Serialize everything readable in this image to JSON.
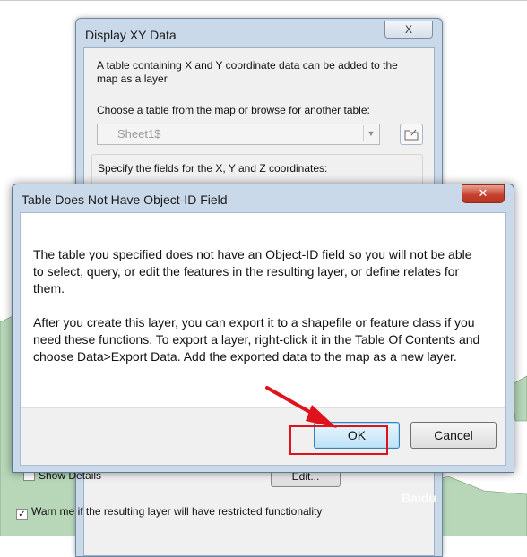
{
  "back_dialog": {
    "title": "Display XY Data",
    "close_label": "X",
    "intro_text": "A table containing X and Y coordinate data can be added to the map as a layer",
    "choose_label": "Choose a table from the map or browse for another table:",
    "table_value": "Sheet1$",
    "fields_label": "Specify the fields for the X, Y and Z coordinates:",
    "show_details_label": "Show Details",
    "edit_label": "Edit...",
    "warn_label": "Warn me if the resulting layer will have restricted functionality",
    "warn_checked": true,
    "show_details_checked": false
  },
  "alert_dialog": {
    "title": "Table Does Not Have Object-ID Field",
    "close_label": "✕",
    "message_1": "The table you specified does not have an Object-ID field so you will not be able to select, query, or edit the features in the resulting layer, or define relates for them.",
    "message_2": "After you create this layer, you can export it to a shapefile or feature class if you need these functions. To export a layer, right-click it in the Table Of Contents and choose Data>Export Data. Add the exported data to the map as a new layer.",
    "ok_label": "OK",
    "cancel_label": "Cancel"
  },
  "watermark": "Baidu",
  "colors": {
    "highlight": "#e0121b",
    "map_fill": "#b7d7b8"
  }
}
